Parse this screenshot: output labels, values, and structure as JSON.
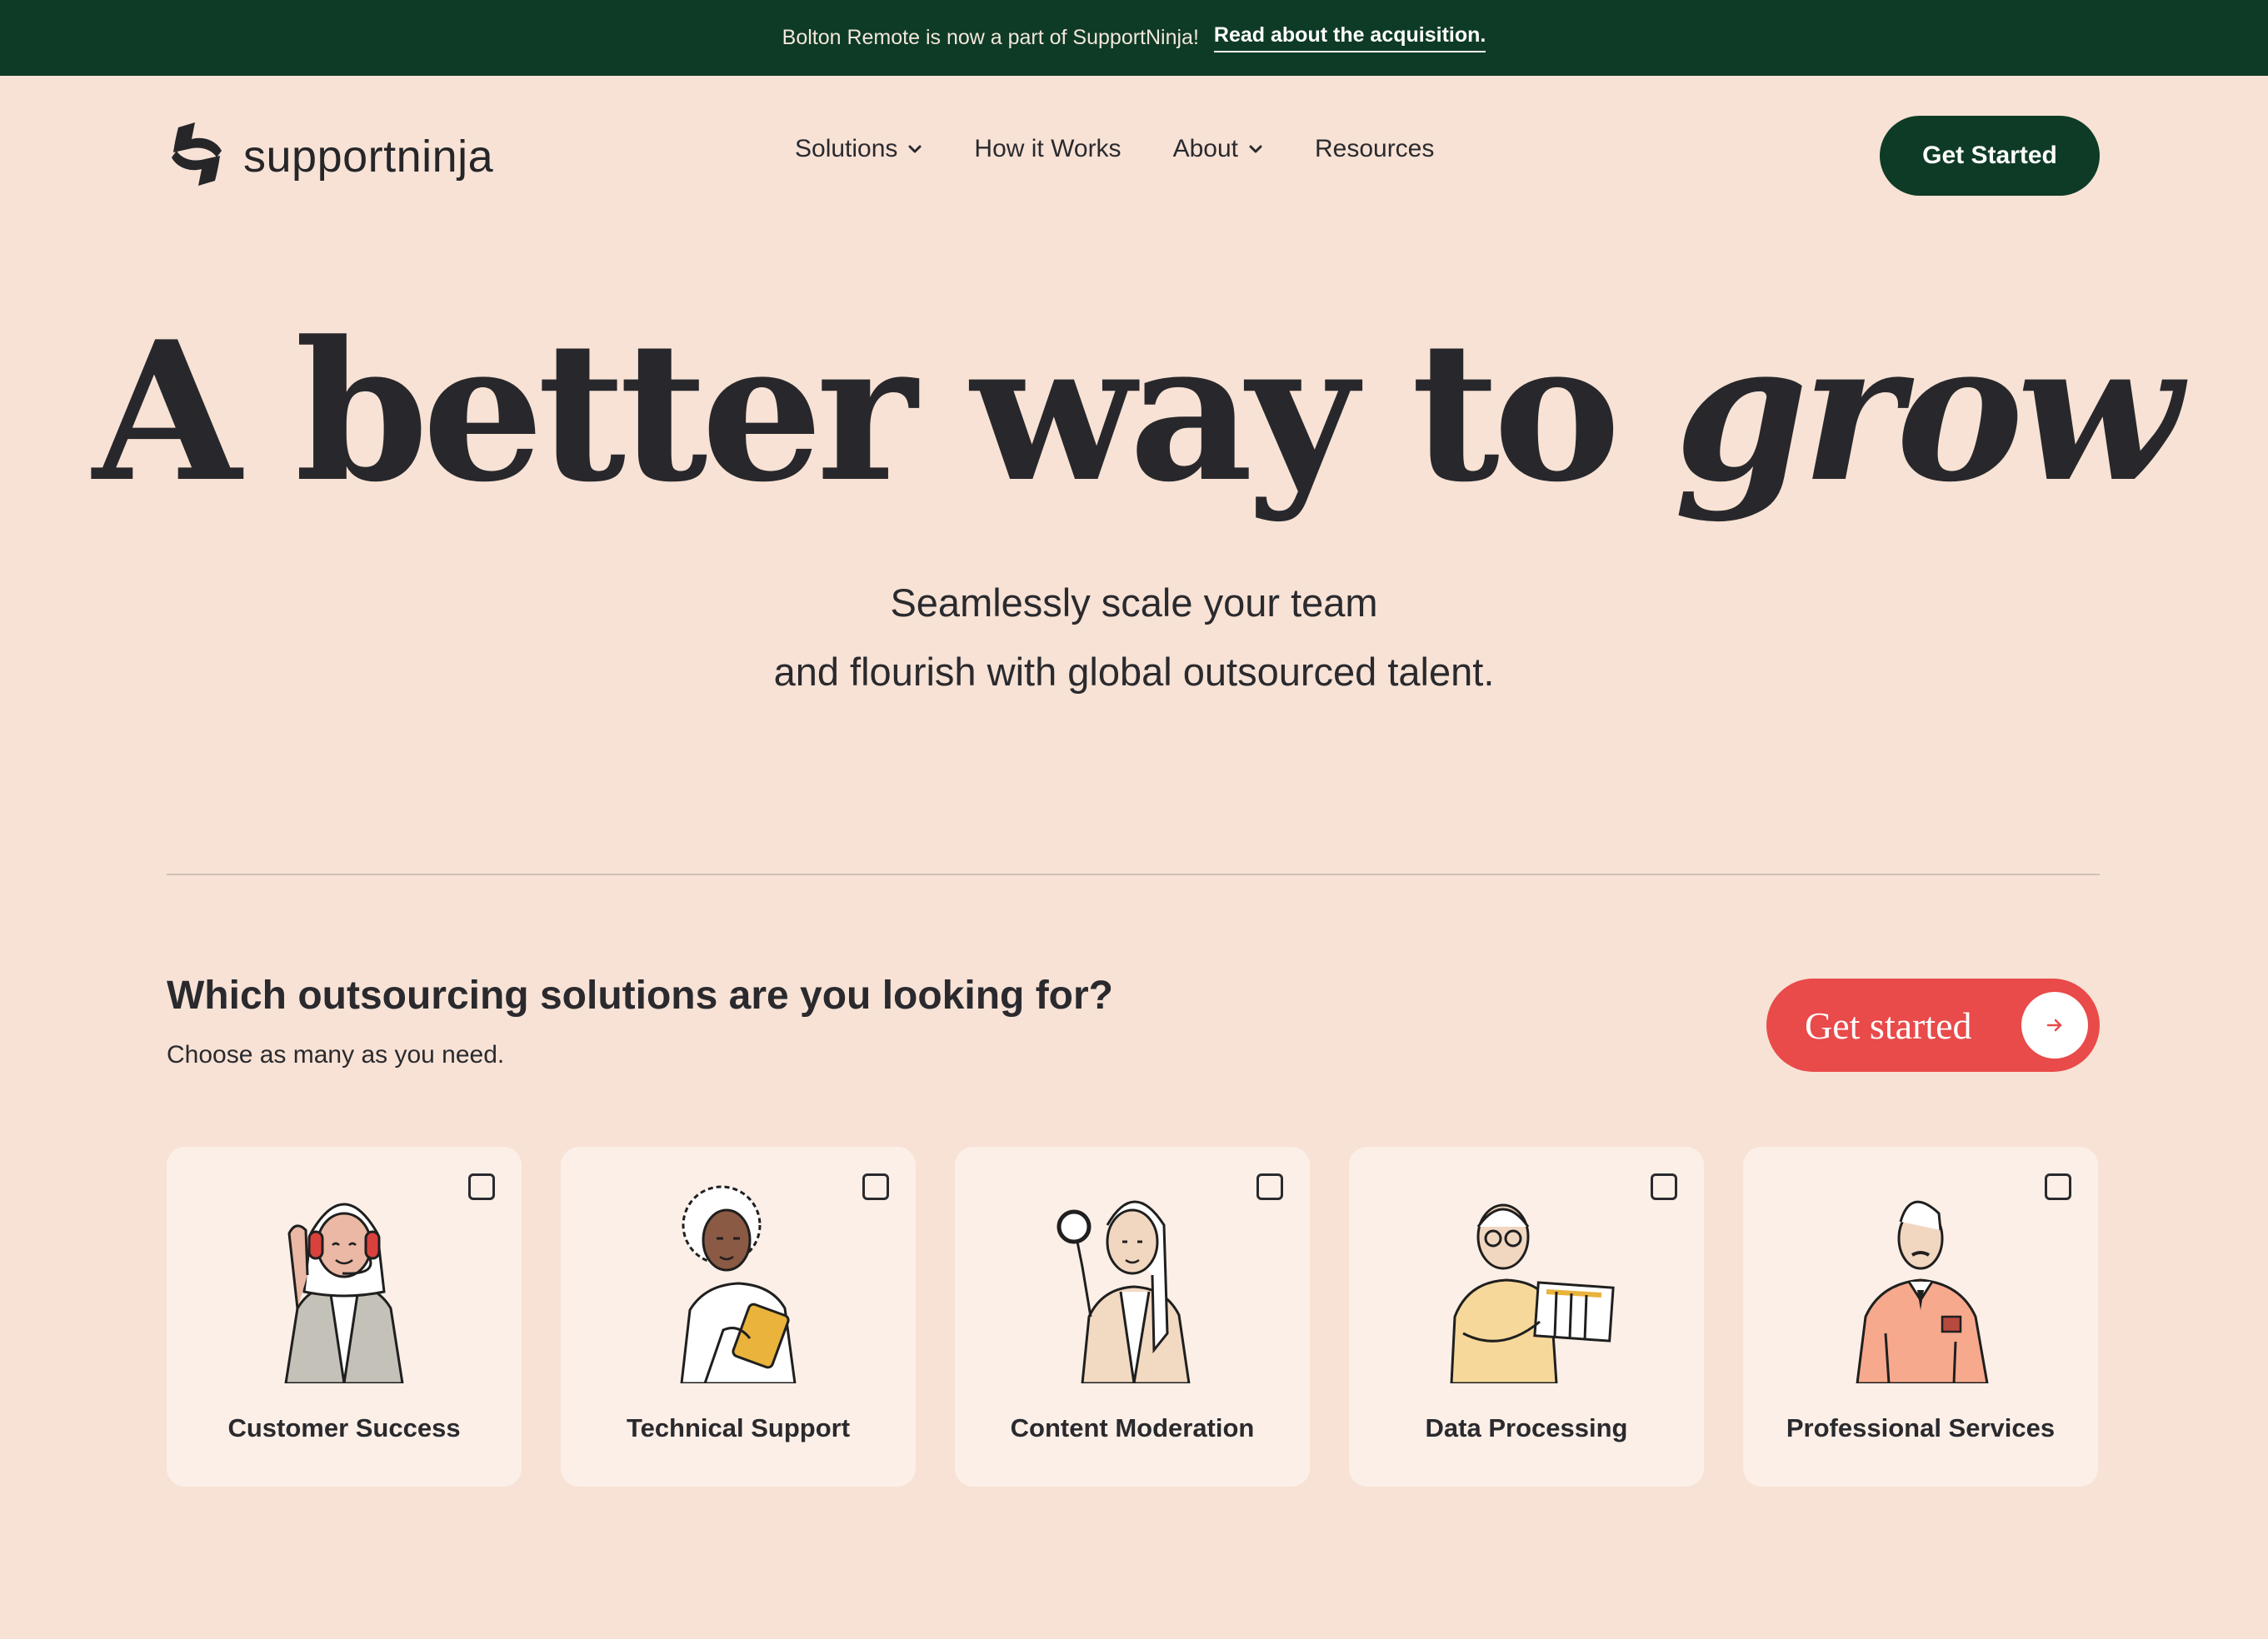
{
  "announcement": {
    "text": "Bolton Remote is now a part of SupportNinja!",
    "link_label": "Read about the acquisition."
  },
  "header": {
    "logo_text": "supportninja",
    "nav": [
      {
        "label": "Solutions",
        "has_dropdown": true
      },
      {
        "label": "How it Works",
        "has_dropdown": false
      },
      {
        "label": "About",
        "has_dropdown": true
      },
      {
        "label": "Resources",
        "has_dropdown": false
      }
    ],
    "cta_label": "Get Started"
  },
  "hero": {
    "title_main": "A better way to ",
    "title_italic": "grow",
    "subtitle_line1": "Seamlessly scale your team",
    "subtitle_line2": "and flourish with global outsourced talent."
  },
  "solutions": {
    "question": "Which outsourcing solutions are you looking for?",
    "hint": "Choose as many as you need.",
    "cta_label": "Get started",
    "cards": [
      {
        "label": "Customer Success",
        "checked": false,
        "icon": "headset-agent-illustration"
      },
      {
        "label": "Technical Support",
        "checked": false,
        "icon": "tablet-tech-illustration"
      },
      {
        "label": "Content Moderation",
        "checked": false,
        "icon": "magnifier-moderator-illustration"
      },
      {
        "label": "Data Processing",
        "checked": false,
        "icon": "chart-board-illustration"
      },
      {
        "label": "Professional Services",
        "checked": false,
        "icon": "sweater-professional-illustration"
      }
    ]
  },
  "colors": {
    "background": "#f7e2d5",
    "announcement_bg": "#0e3b25",
    "primary_button": "#0e3b25",
    "accent_red": "#e94a4a",
    "card_bg": "#fcefe7",
    "text": "#2a2a2e"
  }
}
